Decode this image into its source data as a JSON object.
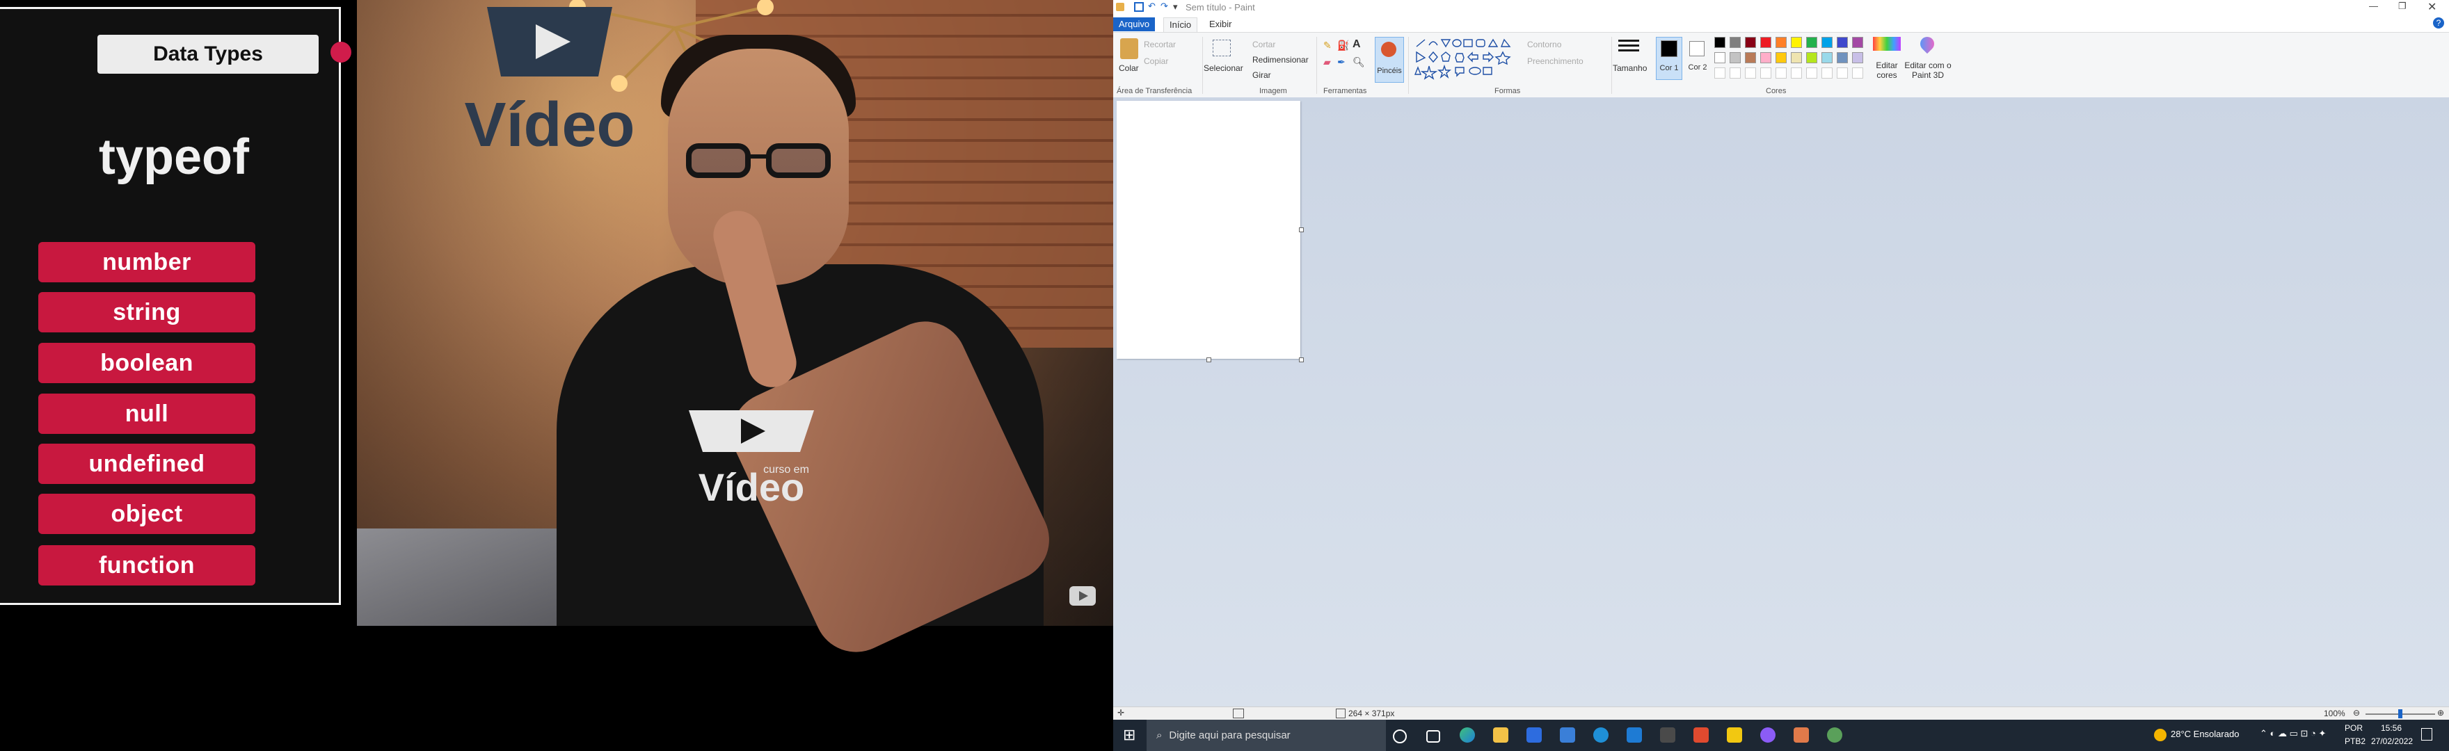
{
  "video": {
    "overlay_title": "Data Types",
    "heading": "typeof",
    "types": [
      "number",
      "string",
      "boolean",
      "null",
      "undefined",
      "object",
      "function"
    ],
    "wall_logo_text": "Vídeo",
    "shirt_logo_small": "curso em",
    "shirt_logo_text": "Vídeo"
  },
  "paint": {
    "window_title": "Sem título - Paint",
    "tabs": [
      "Arquivo",
      "Início",
      "Exibir"
    ],
    "clipboard": {
      "paste": "Colar",
      "cut": "Recortar",
      "copy": "Copiar",
      "label": "Área de Transferência"
    },
    "image": {
      "select": "Selecionar",
      "crop": "Cortar",
      "resize": "Redimensionar",
      "rotate": "Girar",
      "label": "Imagem"
    },
    "tools": {
      "brushes": "Pincéis",
      "label": "Ferramentas"
    },
    "shapes": {
      "outline": "Contorno",
      "fill": "Preenchimento",
      "label": "Formas"
    },
    "size": "Tamanho",
    "color1": "Cor 1",
    "color2": "Cor 2",
    "edit_colors": "Editar cores",
    "edit_paint3d": "Editar com o Paint 3D",
    "colors_label": "Cores",
    "palette": [
      "#000000",
      "#7f7f7f",
      "#880015",
      "#ed1c24",
      "#ff7f27",
      "#fff200",
      "#22b14c",
      "#00a2e8",
      "#3f48cc",
      "#a349a4",
      "#ffffff",
      "#c3c3c3",
      "#b97a57",
      "#ffaec9",
      "#ffc90e",
      "#efe4b0",
      "#b5e61d",
      "#99d9ea",
      "#7092be",
      "#c8bfe7"
    ],
    "status_size": "264 × 371px",
    "zoom": "100%"
  },
  "taskbar": {
    "search_placeholder": "Digite aqui para pesquisar",
    "weather": "28°C  Ensolarado",
    "lang": "POR",
    "layout": "PTB2",
    "time": "15:56",
    "date": "27/02/2022"
  }
}
